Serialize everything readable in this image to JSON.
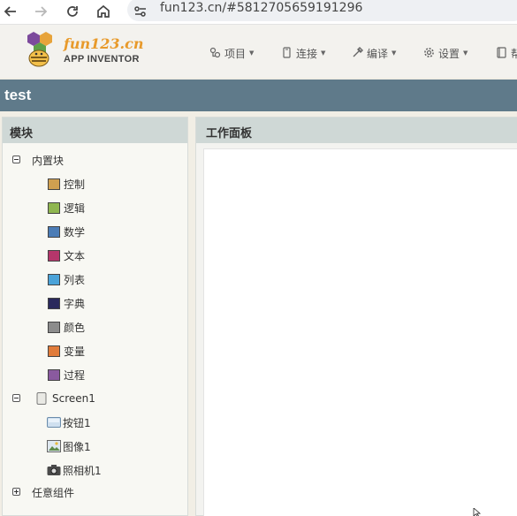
{
  "browser": {
    "url": "fun123.cn/#5812705659191296",
    "icons": [
      "back-icon",
      "forward-icon",
      "reload-icon",
      "home-icon",
      "site-info-icon"
    ]
  },
  "header": {
    "brand_name": "fun123.cn",
    "brand_sub": "APP INVENTOR",
    "menu": [
      {
        "label": "项目",
        "icon": "project-icon"
      },
      {
        "label": "连接",
        "icon": "connect-icon"
      },
      {
        "label": "编译",
        "icon": "build-icon"
      },
      {
        "label": "设置",
        "icon": "gear-icon"
      },
      {
        "label": "帮",
        "icon": "help-icon"
      }
    ]
  },
  "project": {
    "title": "test"
  },
  "blocks": {
    "title": "模块",
    "builtin": {
      "label": "内置块",
      "expanded": true,
      "items": [
        {
          "label": "控制",
          "color": "#d0a050"
        },
        {
          "label": "逻辑",
          "color": "#8fb650"
        },
        {
          "label": "数学",
          "color": "#4b7cb6"
        },
        {
          "label": "文本",
          "color": "#b5366b"
        },
        {
          "label": "列表",
          "color": "#4ba3d9"
        },
        {
          "label": "字典",
          "color": "#2b2a5c"
        },
        {
          "label": "颜色",
          "color": "#8c8c8c"
        },
        {
          "label": "变量",
          "color": "#e07b3a"
        },
        {
          "label": "过程",
          "color": "#8a5a9f"
        }
      ]
    },
    "screen": {
      "label": "Screen1",
      "expanded": true,
      "items": [
        {
          "label": "按钮1",
          "icon": "button-icon"
        },
        {
          "label": "图像1",
          "icon": "image-icon"
        },
        {
          "label": "照相机1",
          "icon": "camera-icon"
        }
      ]
    },
    "any_component": {
      "label": "任意组件",
      "expanded": false
    }
  },
  "workspace": {
    "title": "工作面板"
  }
}
